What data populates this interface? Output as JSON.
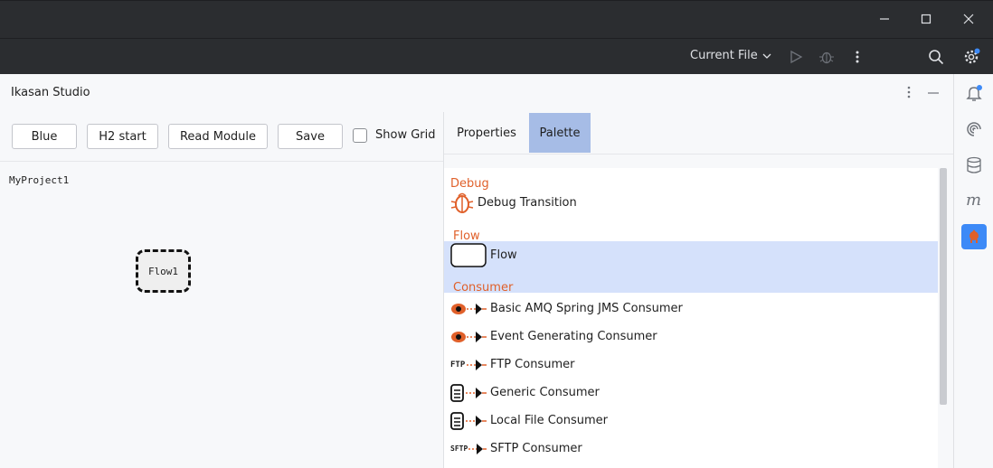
{
  "window": {
    "minimize_label": "–",
    "maximize_label": "☐",
    "close_label": "✕"
  },
  "toolbar": {
    "run_config": "Current File",
    "icons": [
      "run-icon",
      "debug-icon",
      "more-vert-icon",
      "search-icon",
      "settings-icon"
    ]
  },
  "panel": {
    "title": "Ikasan Studio"
  },
  "left": {
    "buttons": {
      "blue": "Blue",
      "h2_start": "H2 start",
      "read_module": "Read Module",
      "save": "Save"
    },
    "show_grid": {
      "label": "Show Grid",
      "checked": false
    },
    "canvas": {
      "project_name": "MyProject1",
      "flow_node": "Flow1"
    }
  },
  "right": {
    "tabs": [
      {
        "label": "Properties",
        "active": false
      },
      {
        "label": "Palette",
        "active": true
      }
    ],
    "palette": {
      "categories": {
        "debug": "Debug",
        "flow": "Flow",
        "consumer": "Consumer"
      },
      "items": {
        "debug_transition": "Debug Transition",
        "flow": "Flow",
        "basic_amq": "Basic AMQ Spring JMS Consumer",
        "event_generating": "Event Generating Consumer",
        "ftp": "FTP Consumer",
        "generic": "Generic Consumer",
        "local_file": "Local File Consumer",
        "sftp": "SFTP Consumer"
      },
      "icon_text": {
        "ftp": "FTP",
        "sftp": "SFTP"
      }
    }
  },
  "colors": {
    "accent": "#e0602a",
    "selection": "#d5e1fb",
    "tab_active": "#a6bce6",
    "dark": "#2b2d30"
  }
}
